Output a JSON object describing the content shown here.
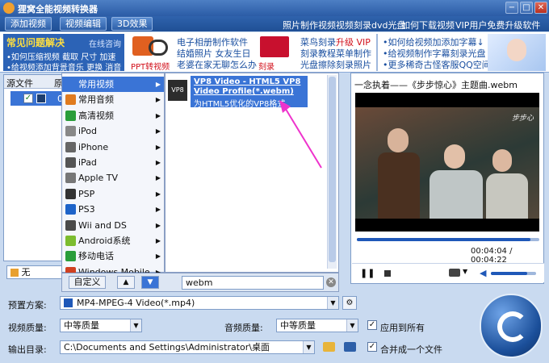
{
  "window": {
    "title": "狸窝全能视频转换器",
    "btn_min": "−",
    "btn_max": "□",
    "btn_close": "✕"
  },
  "toolbar": {
    "add_video": "添加视频",
    "edit_video": "视频编辑",
    "effect_3d": "3D效果",
    "links": [
      "照片制作视频",
      "视频刻录dvd光盘",
      "如何下载视频",
      "VIP用户免费升级软件"
    ]
  },
  "banner": {
    "faq_title": "常见问题解决",
    "online": "在线咨询",
    "faq_lines": [
      "•如何压缩视频  截取  尺寸  加速",
      "•给视频添加背景音乐  更换  消音"
    ],
    "ppt": "PPT转视频",
    "mid_lines": [
      "电子相册制作软件",
      "结婚照片  女友生日",
      "老婆在家无聊怎么办"
    ],
    "dvd": "刻录DVD",
    "c3_lines": [
      "菜鸟刻录",
      "刻录教程",
      "光盘擦除"
    ],
    "c3b_lines": [
      "升级 VIP",
      "菜单制作",
      "刻录照片"
    ],
    "right_lines": [
      "•如何给视频加添加字幕↓",
      "•给视频制作字幕刻录光盘",
      "•更多稀奇古怪客服QQ空间>>"
    ]
  },
  "filelist": {
    "col1": "源文件",
    "col2": "原",
    "row_label": "0",
    "sub_label": "无"
  },
  "menu1": {
    "items": [
      "常用视频",
      "常用音频",
      "高清视频",
      "iPod",
      "iPhone",
      "iPad",
      "Apple TV",
      "PSP",
      "PS3",
      "Wii and DS",
      "Android系统",
      "移动电话",
      "Windows Mobile"
    ],
    "selected": "常用视频"
  },
  "menu2": {
    "item_title": "VP8 Video - HTML5 VP8 Video Profile(*.webm)",
    "item_desc": "为HTML5优化的VP8格式",
    "icon_label": "VP8"
  },
  "menufoot": {
    "custom": "自定义",
    "search_value": "webm",
    "up": "▲",
    "down": "▼"
  },
  "preview": {
    "title": "一念执着——《步步惊心》主题曲.webm",
    "time": "00:04:04 / 00:04:22",
    "progress": 0.95,
    "volume": 0.8
  },
  "settings": {
    "preset_label": "预置方案:",
    "preset_value": "MP4-MPEG-4 Video(*.mp4)",
    "vq_label": "视频质量:",
    "vq_value": "中等质量",
    "aq_label": "音频质量:",
    "aq_value": "中等质量",
    "apply_all": "应用到所有",
    "out_label": "输出目录:",
    "out_value": "C:\\Documents and Settings\\Administrator\\桌面",
    "merge": "合并成一个文件"
  },
  "colors": {
    "accent": "#3a74d6",
    "arrow": "#ee33cc",
    "convert": "#1b4f9a"
  }
}
